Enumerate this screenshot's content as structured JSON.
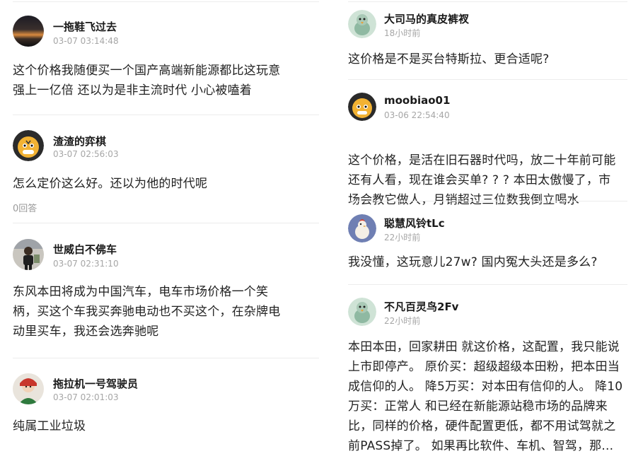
{
  "left_column": {
    "comments": [
      {
        "username": "一拖鞋飞过去",
        "time": "03-07 03:14:48",
        "text_lines": [
          "这个价格我随便买一个国产高端新能源都比这玩意",
          "强上一亿倍 还以为是非主流时代 小心被嗑着"
        ],
        "avatar_icon": "sunset-avatar-icon"
      },
      {
        "username": "渣渣的弈棋",
        "time": "03-07 02:56:03",
        "text_lines": [
          "怎么定价这么好。还以为他的时代呢"
        ],
        "replies": "0回答",
        "avatar_icon": "tiger-avatar-icon"
      },
      {
        "username": "世威白不佛车",
        "time": "03-07 02:31:10",
        "text_lines": [
          "东风本田将成为中国汽车，电车市场价格一个笑",
          "柄，买这个车我买奔驰电动也不买这个，在杂牌电",
          "动里买车，我还会选奔驰呢"
        ],
        "avatar_icon": "person-avatar-icon"
      },
      {
        "username": "拖拉机一号驾驶员",
        "time": "03-07 02:01:03",
        "text_lines": [
          "纯属工业垃圾"
        ],
        "avatar_icon": "character-avatar-icon"
      }
    ]
  },
  "right_column": {
    "comments": [
      {
        "username": "大司马的真皮裤衩",
        "time": "18小时前",
        "text_lines": [
          "这价格是不是买台特斯拉、更合适呢?"
        ],
        "avatar_icon": "bird-avatar-icon"
      },
      {
        "username": "moobiao01",
        "time": "03-06 22:54:40",
        "text_lines": [
          "这个价格，是活在旧石器时代吗，放二十年前可能",
          "还有人看，现在谁会买单? ? ? 本田太傲慢了，市",
          "场会教它做人，月销超过三位数我倒立喝水"
        ],
        "avatar_icon": "tiger-avatar-icon"
      },
      {
        "username": "聪慧风铃tLc",
        "time": "22小时前",
        "text_lines": [
          "我没懂，这玩意儿27w? 国内冤大头还是多么?"
        ],
        "avatar_icon": "rooster-avatar-icon"
      },
      {
        "username": "不凡百灵鸟2Fv",
        "time": "22小时前",
        "text_lines": [
          "本田本田，回家耕田 就这价格，这配置，我只能说",
          "上市即停产。 原价买：超级超级本田粉，把本田当",
          "成信仰的人。 降5万买：对本田有信仰的人。 降10",
          "万买：正常人 和已经在新能源站稳市场的品牌来",
          "比，同样的价格，硬件配置更低，都不用试驾就之",
          "前PASS掉了。 如果再比软件、车机、智驾，那..."
        ],
        "avatar_icon": "bird-avatar-icon"
      }
    ]
  }
}
